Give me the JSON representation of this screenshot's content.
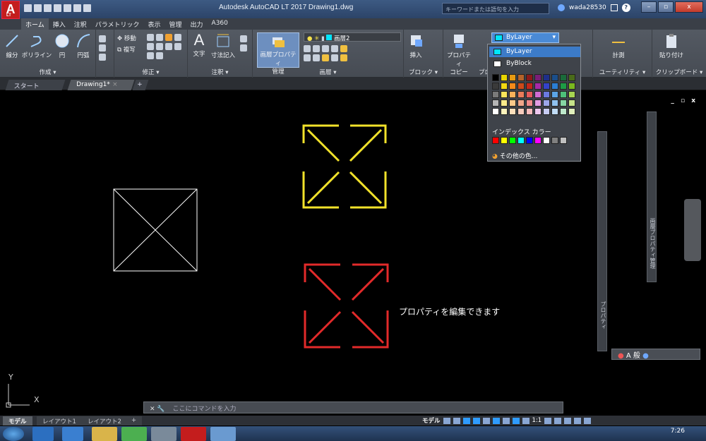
{
  "titlebar": {
    "title": "Autodesk AutoCAD LT 2017    Drawing1.dwg",
    "search_placeholder": "キーワードまたは語句を入力",
    "user": "wada28530",
    "logo_sub": "LT"
  },
  "ribbon_tabs": [
    "ホーム",
    "挿入",
    "注釈",
    "パラメトリック",
    "表示",
    "管理",
    "出力",
    "A360"
  ],
  "ribbon": {
    "draw": {
      "line": "線分",
      "polyline": "ポリライン",
      "circle": "円",
      "arc": "円弧",
      "label": "作成 ▾"
    },
    "modify": {
      "move": "移動",
      "copy": "複写",
      "label": "修正 ▾"
    },
    "annotation": {
      "text": "文字",
      "dimension": "寸法記入",
      "label": "注釈 ▾"
    },
    "layers": {
      "props": "画層プロパティ",
      "props2": "管理",
      "layer_name": "画層2",
      "label": "画層 ▾"
    },
    "block": {
      "insert": "挿入",
      "label": "ブロック ▾"
    },
    "properties": {
      "match": "プロパティ",
      "match2": "コピー",
      "label": "プロ"
    },
    "utilities": {
      "measure": "計測",
      "label": "ユーティリティ ▾"
    },
    "clipboard": {
      "paste": "貼り付け",
      "label": "クリップボード ▾"
    }
  },
  "color_dropdown": {
    "current": "ByLayer",
    "options": [
      "ByLayer",
      "ByBlock"
    ],
    "index_label": "インデックス カラー",
    "more": "その他の色...",
    "grid": [
      "#000000",
      "#e8d500",
      "#e79a12",
      "#b5632a",
      "#8b1a1a",
      "#7a1e78",
      "#1e2f8a",
      "#1b4e8a",
      "#1a6b3a",
      "#4a6b1a",
      "#3a3a3a",
      "#f2d812",
      "#f58a1a",
      "#cc4a1a",
      "#c1261a",
      "#a62aa8",
      "#3342c9",
      "#2b7ed3",
      "#1d9b45",
      "#7ab81f",
      "#7a7a7a",
      "#fae55a",
      "#fab25a",
      "#e97c5a",
      "#e55a5a",
      "#d06cd2",
      "#6b7ae0",
      "#5ba4e6",
      "#4dc07a",
      "#a8d652",
      "#b5b5b5",
      "#fbeb8a",
      "#fbc98a",
      "#f1a68a",
      "#f08a8a",
      "#e29ce3",
      "#9ca6ea",
      "#8fc2ef",
      "#86d6a3",
      "#c6e48a",
      "#ffffff",
      "#fdf3bc",
      "#fde0bc",
      "#f6cbbc",
      "#f6bcbc",
      "#edc7ee",
      "#c7ccf3",
      "#c1dcf6",
      "#bde8cb",
      "#e0f0bc"
    ],
    "index_row": [
      "#ff0000",
      "#ffff00",
      "#00ff00",
      "#00ffff",
      "#0000ff",
      "#ff00ff",
      "#ffffff",
      "#808080",
      "#c0c0c0"
    ]
  },
  "doc_tabs": [
    "スタート",
    "Drawing1*"
  ],
  "canvas": {
    "annotation": "プロパティを編集できます",
    "vp_controls": "_ ▫ x"
  },
  "palettes": {
    "properties": "プロパティ",
    "layer_props": "画層プロパティ管理"
  },
  "command": {
    "placeholder": "ここにコマンドを入力"
  },
  "layout_tabs": [
    "モデル",
    "レイアウト1",
    "レイアウト2"
  ],
  "status": {
    "model": "モデル",
    "scale": "1:1"
  },
  "taskbar": {
    "time": "7:26"
  }
}
